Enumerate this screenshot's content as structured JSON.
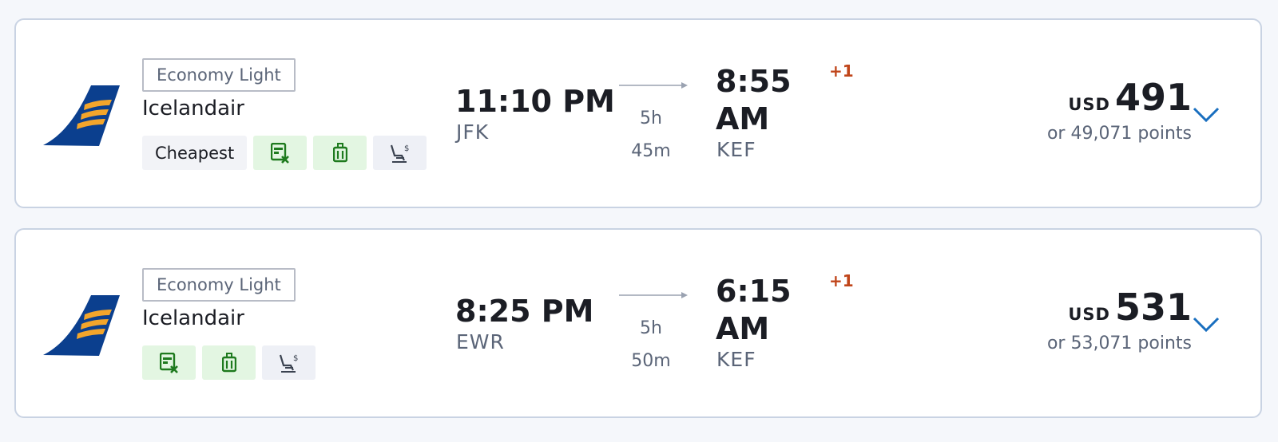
{
  "colors": {
    "accent_blue": "#1a6fbf",
    "airline_navy": "#0b3f8e",
    "airline_gold": "#f3a52b",
    "green_badge_bg": "#e3f6e2",
    "green_icon": "#1e7a1e",
    "day_offset": "#c0451a"
  },
  "flights": [
    {
      "fare_class": "Economy Light",
      "airline": "Icelandair",
      "tag": "Cheapest",
      "icons": [
        "no-change-fee-icon",
        "carry-on-bag-icon",
        "seat-fee-icon"
      ],
      "departure": {
        "time": "11:10 PM",
        "airport": "JFK"
      },
      "duration": {
        "hours": "5h",
        "minutes": "45m"
      },
      "arrival": {
        "time": "8:55 AM",
        "airport": "KEF",
        "day_offset": "+1"
      },
      "price": {
        "currency": "USD",
        "amount": "491",
        "points": "or 49,071 points"
      }
    },
    {
      "fare_class": "Economy Light",
      "airline": "Icelandair",
      "tag": null,
      "icons": [
        "no-change-fee-icon",
        "carry-on-bag-icon",
        "seat-fee-icon"
      ],
      "departure": {
        "time": "8:25 PM",
        "airport": "EWR"
      },
      "duration": {
        "hours": "5h",
        "minutes": "50m"
      },
      "arrival": {
        "time": "6:15 AM",
        "airport": "KEF",
        "day_offset": "+1"
      },
      "price": {
        "currency": "USD",
        "amount": "531",
        "points": "or 53,071 points"
      }
    }
  ]
}
